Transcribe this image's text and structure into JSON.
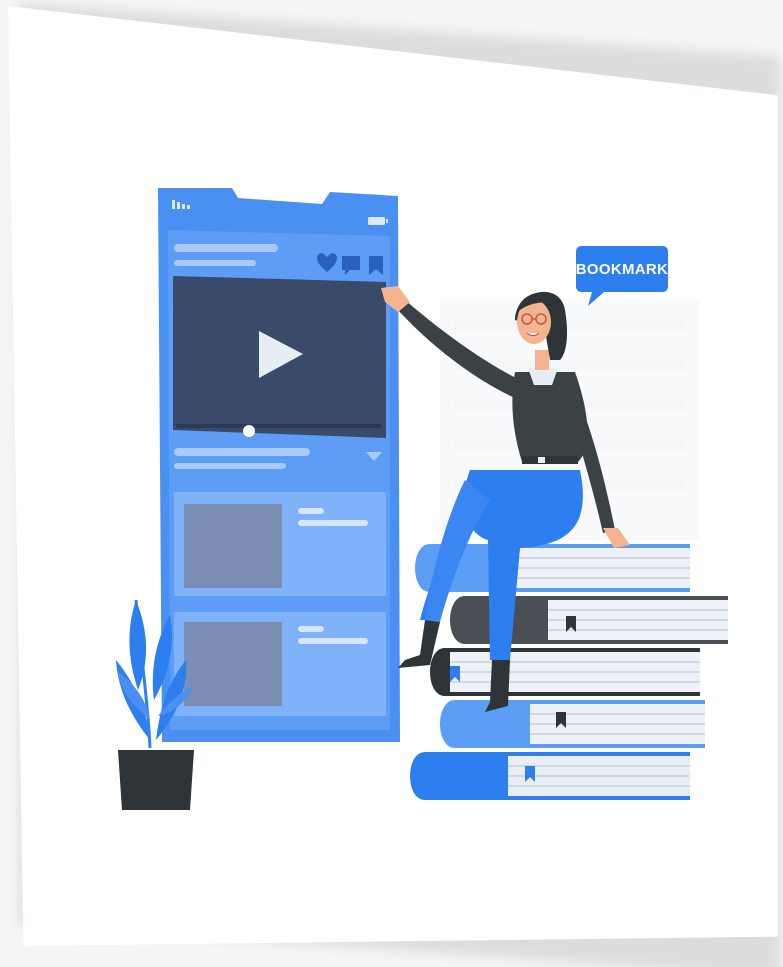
{
  "illustration": {
    "speech_bubble_text": "BOOKMARK"
  },
  "icons": {
    "play": "play-icon",
    "heart": "heart-icon",
    "comment": "comment-icon",
    "bookmark": "bookmark-icon",
    "signal": "signal-icon",
    "battery": "battery-icon"
  },
  "colors": {
    "accent": "#2d7ff0",
    "accent_light": "#5a9ef5",
    "screen_dark": "#3a4a6b",
    "dark_gray": "#3b4246",
    "pot": "#2e3437",
    "page_bg": "#ffffff"
  }
}
